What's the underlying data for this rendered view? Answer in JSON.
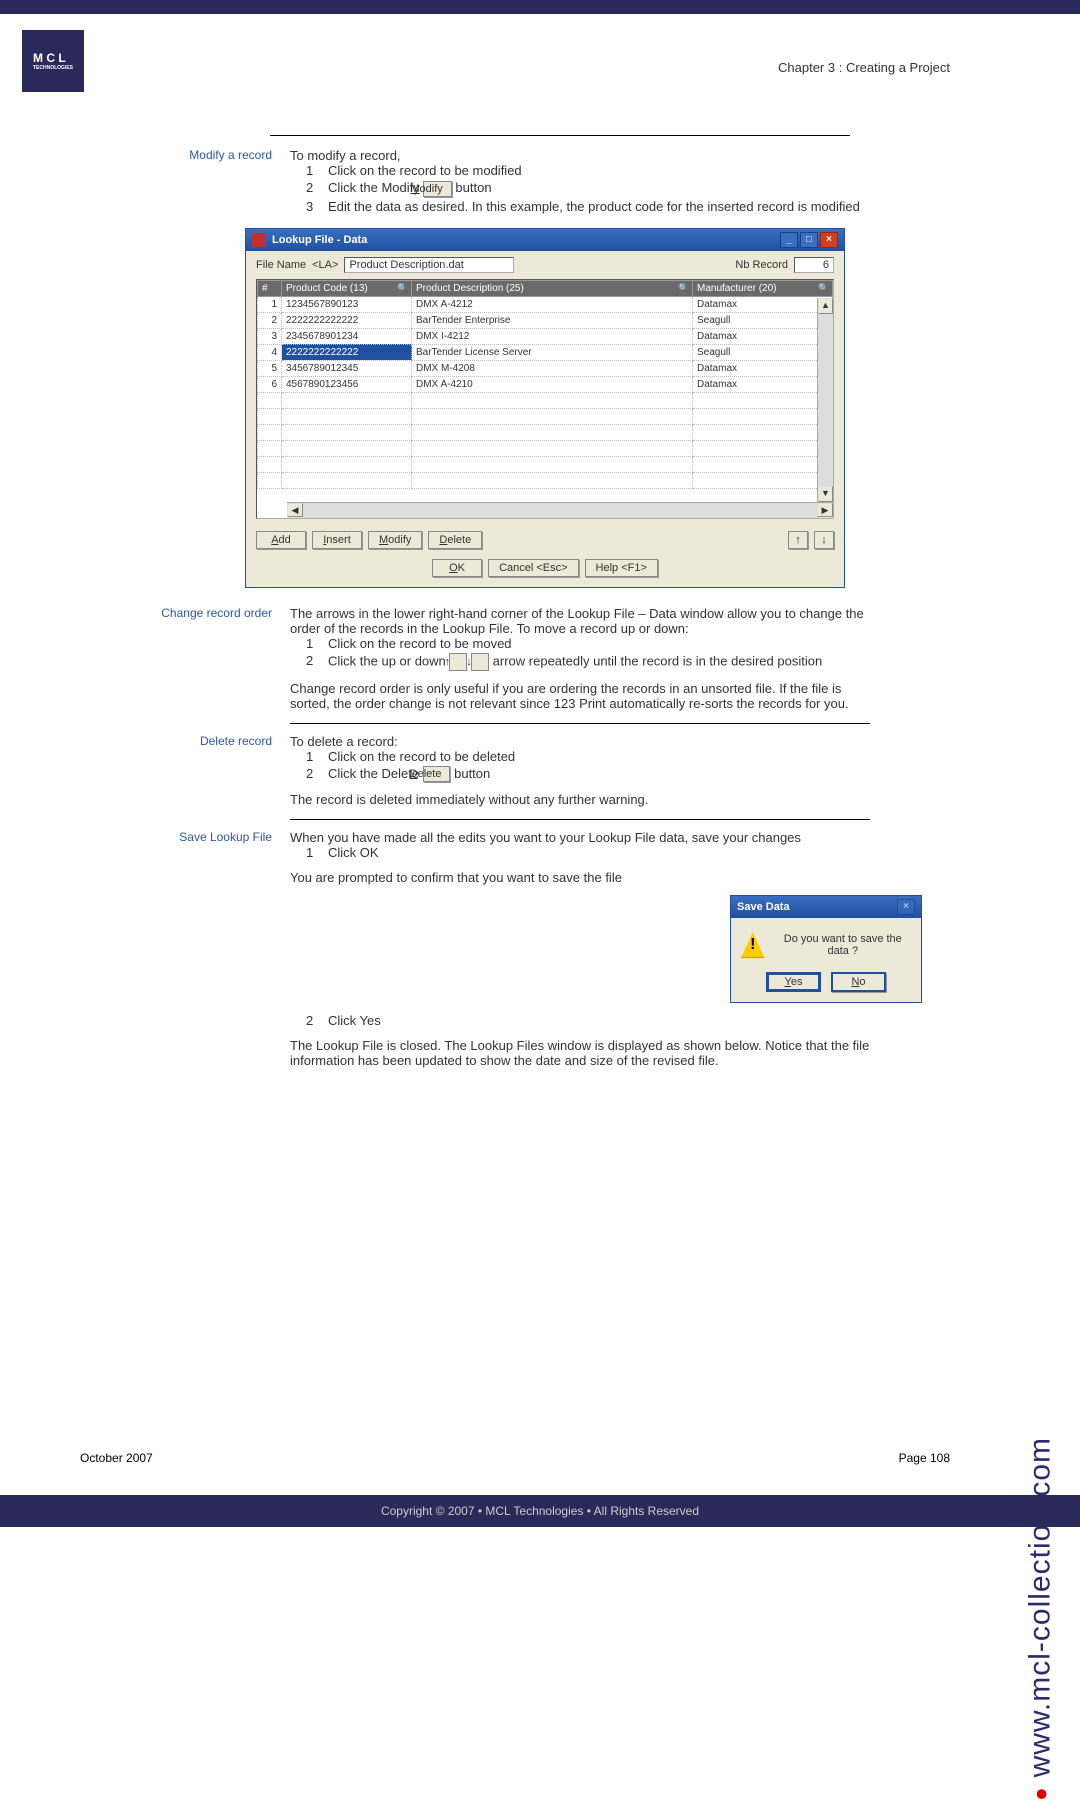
{
  "chapter": "Chapter 3 : Creating a Project",
  "logo_text": "M C L",
  "logo_sub": "TECHNOLOGIES",
  "side_url": "www.mcl-collection.com",
  "sections": {
    "modify": {
      "label": "Modify a record",
      "intro": "To modify a record,",
      "steps": [
        "Click on the record to be modified",
        "Click the Modify",
        "Edit the data as desired. In this example, the product code for the inserted record is modified"
      ],
      "modify_btn": "Modify",
      "button_suffix": "button"
    },
    "change": {
      "label": "Change record order",
      "p1": "The arrows in the lower right-hand corner of the Lookup File – Data window allow you to change the order of the records in the Lookup File. To move a record up or down:",
      "steps": [
        "Click on the record to be moved",
        "Click the up or down"
      ],
      "step2_suffix": "arrow repeatedly until the record is in the desired position",
      "p2": "Change record order is only useful if you are ordering the records in an unsorted file. If the file is sorted, the order change is not relevant since 123 Print automatically re-sorts the records for you."
    },
    "delete": {
      "label": "Delete record",
      "intro": "To delete a record:",
      "steps": [
        "Click on the record to be deleted",
        "Click the Delete"
      ],
      "delete_btn": "Delete",
      "button_suffix": "button",
      "p2": "The record is deleted immediately without any further warning."
    },
    "save": {
      "label": "Save Lookup File",
      "p1": "When you have made all the edits you want to your Lookup File data, save your changes",
      "step1": "Click OK",
      "p2": "You are prompted to confirm that you want to save the file",
      "step2": "Click Yes",
      "p3": "The Lookup File is closed. The Lookup Files window is displayed as shown below. Notice that the file information has been updated to show the date and size of the revised file."
    }
  },
  "lookup": {
    "title": "Lookup File - Data",
    "file_label": "File Name",
    "file_var": "<LA>",
    "file_name": "Product Description.dat",
    "nb_label": "Nb Record",
    "nb_value": "6",
    "cols": [
      "#",
      "Product Code (13)",
      "Product Description (25)",
      "Manufacturer (20)"
    ],
    "rows": [
      [
        "1",
        "1234567890123",
        "DMX A-4212",
        "Datamax"
      ],
      [
        "2",
        "2222222222222",
        "BarTender Enterprise",
        "Seagull"
      ],
      [
        "3",
        "2345678901234",
        "DMX I-4212",
        "Datamax"
      ],
      [
        "4",
        "2222222222222",
        "BarTender License Server",
        "Seagull"
      ],
      [
        "5",
        "3456789012345",
        "DMX M-4208",
        "Datamax"
      ],
      [
        "6",
        "4567890123456",
        "DMX A-4210",
        "Datamax"
      ]
    ],
    "selected_row": 3,
    "selected_col": 1,
    "btns": {
      "add": "Add",
      "insert": "Insert",
      "modify": "Modify",
      "delete": "Delete",
      "up": "↑",
      "down": "↓"
    },
    "bottom": {
      "ok": "OK",
      "cancel": "Cancel <Esc>",
      "help": "Help <F1>"
    }
  },
  "save_dlg": {
    "title": "Save Data",
    "msg": "Do you want to save the data ?",
    "yes": "Yes",
    "no": "No"
  },
  "footer": {
    "date": "October 2007",
    "page": "Page 108",
    "copyright": "Copyright © 2007 • MCL Technologies • All Rights Reserved"
  }
}
